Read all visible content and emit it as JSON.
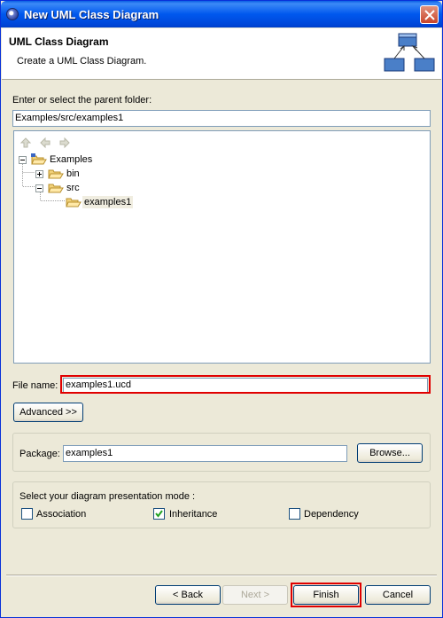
{
  "window": {
    "title": "New UML Class Diagram"
  },
  "header": {
    "title": "UML Class Diagram",
    "description": "Create a UML Class Diagram."
  },
  "folder": {
    "label": "Enter or select the parent folder:",
    "value": "Examples/src/examples1"
  },
  "tree": {
    "items": [
      {
        "label": "Examples"
      },
      {
        "label": "bin"
      },
      {
        "label": "src"
      },
      {
        "label": "examples1"
      }
    ]
  },
  "file": {
    "label": "File name:",
    "value": "examples1.ucd"
  },
  "advanced": {
    "label": "Advanced >>"
  },
  "package": {
    "label": "Package:",
    "value": "examples1",
    "browse_label": "Browse..."
  },
  "mode": {
    "label": "Select your diagram presentation mode :",
    "options": [
      {
        "label": "Association",
        "checked": false
      },
      {
        "label": "Inheritance",
        "checked": true
      },
      {
        "label": "Dependency",
        "checked": false
      }
    ]
  },
  "buttons": {
    "back": "< Back",
    "next": "Next >",
    "finish": "Finish",
    "cancel": "Cancel"
  }
}
